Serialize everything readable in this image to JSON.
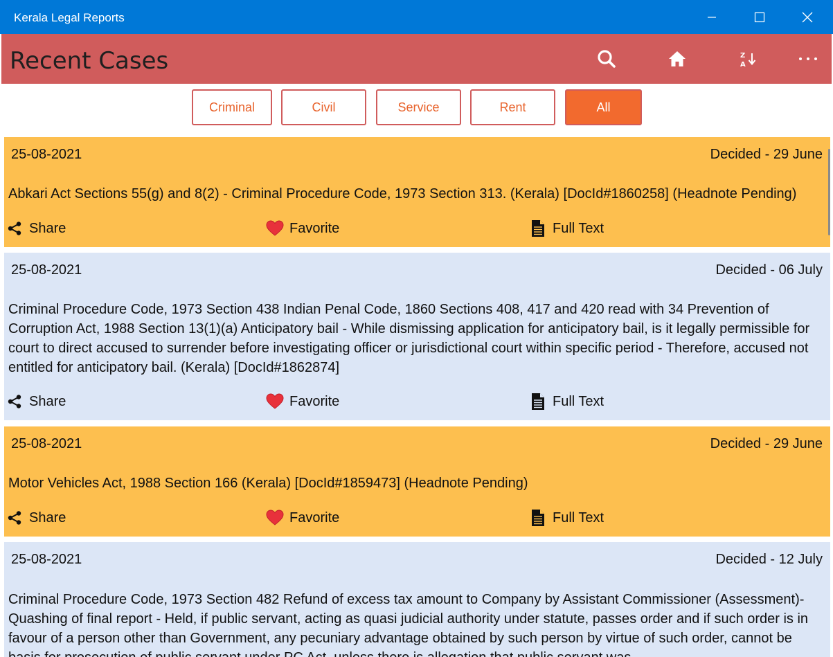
{
  "window": {
    "title": "Kerala Legal Reports"
  },
  "header": {
    "title": "Recent Cases",
    "icons": [
      "search-icon",
      "home-icon",
      "sort-az-icon",
      "more-icon"
    ]
  },
  "filters": [
    {
      "label": "Criminal",
      "active": false
    },
    {
      "label": "Civil",
      "active": false
    },
    {
      "label": "Service",
      "active": false
    },
    {
      "label": "Rent",
      "active": false
    },
    {
      "label": "All",
      "active": true
    }
  ],
  "actions": {
    "share": "Share",
    "favorite": "Favorite",
    "full_text": "Full Text"
  },
  "cases": [
    {
      "date": "25-08-2021",
      "decided": "Decided - 29 June",
      "headnote": "Abkari Act Sections 55(g) and 8(2) - Criminal Procedure Code, 1973 Section 313. (Kerala) [DocId#1860258] (Headnote Pending)"
    },
    {
      "date": "25-08-2021",
      "decided": "Decided - 06 July",
      "headnote": "Criminal Procedure Code, 1973 Section 438  Indian Penal Code, 1860 Sections 408, 417 and 420 read with 34  Prevention of Corruption Act, 1988 Section 13(1)(a)  Anticipatory bail - While dismissing application for anticipatory bail, is it legally permissible for court to direct accused to surrender before investigating officer or jurisdictional court within specific period - Therefore, accused not entitled for anticipatory bail. (Kerala) [DocId#1862874]"
    },
    {
      "date": "25-08-2021",
      "decided": "Decided - 29 June",
      "headnote": "Motor Vehicles Act, 1988 Section 166  (Kerala) [DocId#1859473] (Headnote Pending)"
    },
    {
      "date": "25-08-2021",
      "decided": "Decided - 12 July",
      "headnote": "Criminal Procedure Code, 1973 Section 482  Refund of excess tax amount to Company by Assistant Commissioner (Assessment)- Quashing of final report - Held, if public servant, acting as quasi judicial authority under statute, passes order and if such order is in favour of a person other than Government, any pecuniary advantage obtained by such person by virtue of such order, cannot be basis for prosecution of public servant under PC Act, unless there is allegation that public servant was"
    }
  ],
  "colors": {
    "titlebar": "#0078d7",
    "header": "#d05c5c",
    "card_orange": "#fdbf4f",
    "card_blue": "#dce6f6",
    "accent": "#f26a2e"
  }
}
